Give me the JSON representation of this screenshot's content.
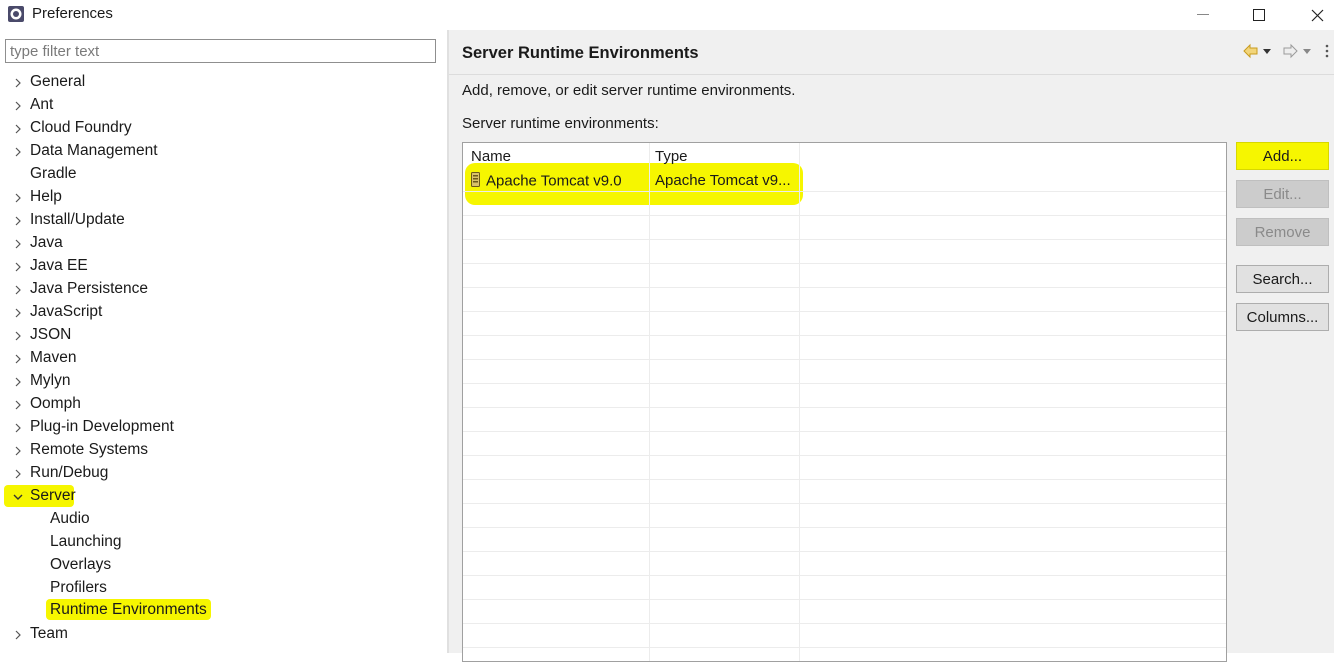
{
  "window": {
    "title": "Preferences",
    "icon": "eclipse-preferences-icon"
  },
  "left": {
    "filter_placeholder": "type filter text",
    "tree": [
      {
        "label": "General",
        "expandable": true
      },
      {
        "label": "Ant",
        "expandable": true
      },
      {
        "label": "Cloud Foundry",
        "expandable": true
      },
      {
        "label": "Data Management",
        "expandable": true
      },
      {
        "label": "Gradle",
        "expandable": false
      },
      {
        "label": "Help",
        "expandable": true
      },
      {
        "label": "Install/Update",
        "expandable": true
      },
      {
        "label": "Java",
        "expandable": true
      },
      {
        "label": "Java EE",
        "expandable": true
      },
      {
        "label": "Java Persistence",
        "expandable": true
      },
      {
        "label": "JavaScript",
        "expandable": true
      },
      {
        "label": "JSON",
        "expandable": true
      },
      {
        "label": "Maven",
        "expandable": true
      },
      {
        "label": "Mylyn",
        "expandable": true
      },
      {
        "label": "Oomph",
        "expandable": true
      },
      {
        "label": "Plug-in Development",
        "expandable": true
      },
      {
        "label": "Remote Systems",
        "expandable": true
      },
      {
        "label": "Run/Debug",
        "expandable": true
      },
      {
        "label": "Server",
        "expandable": true,
        "expanded": true
      },
      {
        "label": "Audio",
        "child": true
      },
      {
        "label": "Launching",
        "child": true
      },
      {
        "label": "Overlays",
        "child": true
      },
      {
        "label": "Profilers",
        "child": true
      },
      {
        "label": "Runtime Environments",
        "child": true,
        "selected": true
      },
      {
        "label": "Team",
        "expandable": true
      }
    ]
  },
  "right": {
    "title": "Server Runtime Environments",
    "description": "Add, remove, or edit server runtime environments.",
    "list_label": "Server runtime environments:",
    "table": {
      "columns": [
        "Name",
        "Type"
      ],
      "rows": [
        {
          "name": "Apache Tomcat v9.0",
          "type": "Apache Tomcat v9...",
          "icon": "tomcat-server-icon"
        }
      ]
    },
    "buttons": {
      "add": "Add...",
      "edit": "Edit...",
      "remove": "Remove",
      "search": "Search...",
      "columns": "Columns..."
    }
  },
  "colors": {
    "highlight": "#f6f600",
    "panel_bg": "#f0f0f0"
  }
}
